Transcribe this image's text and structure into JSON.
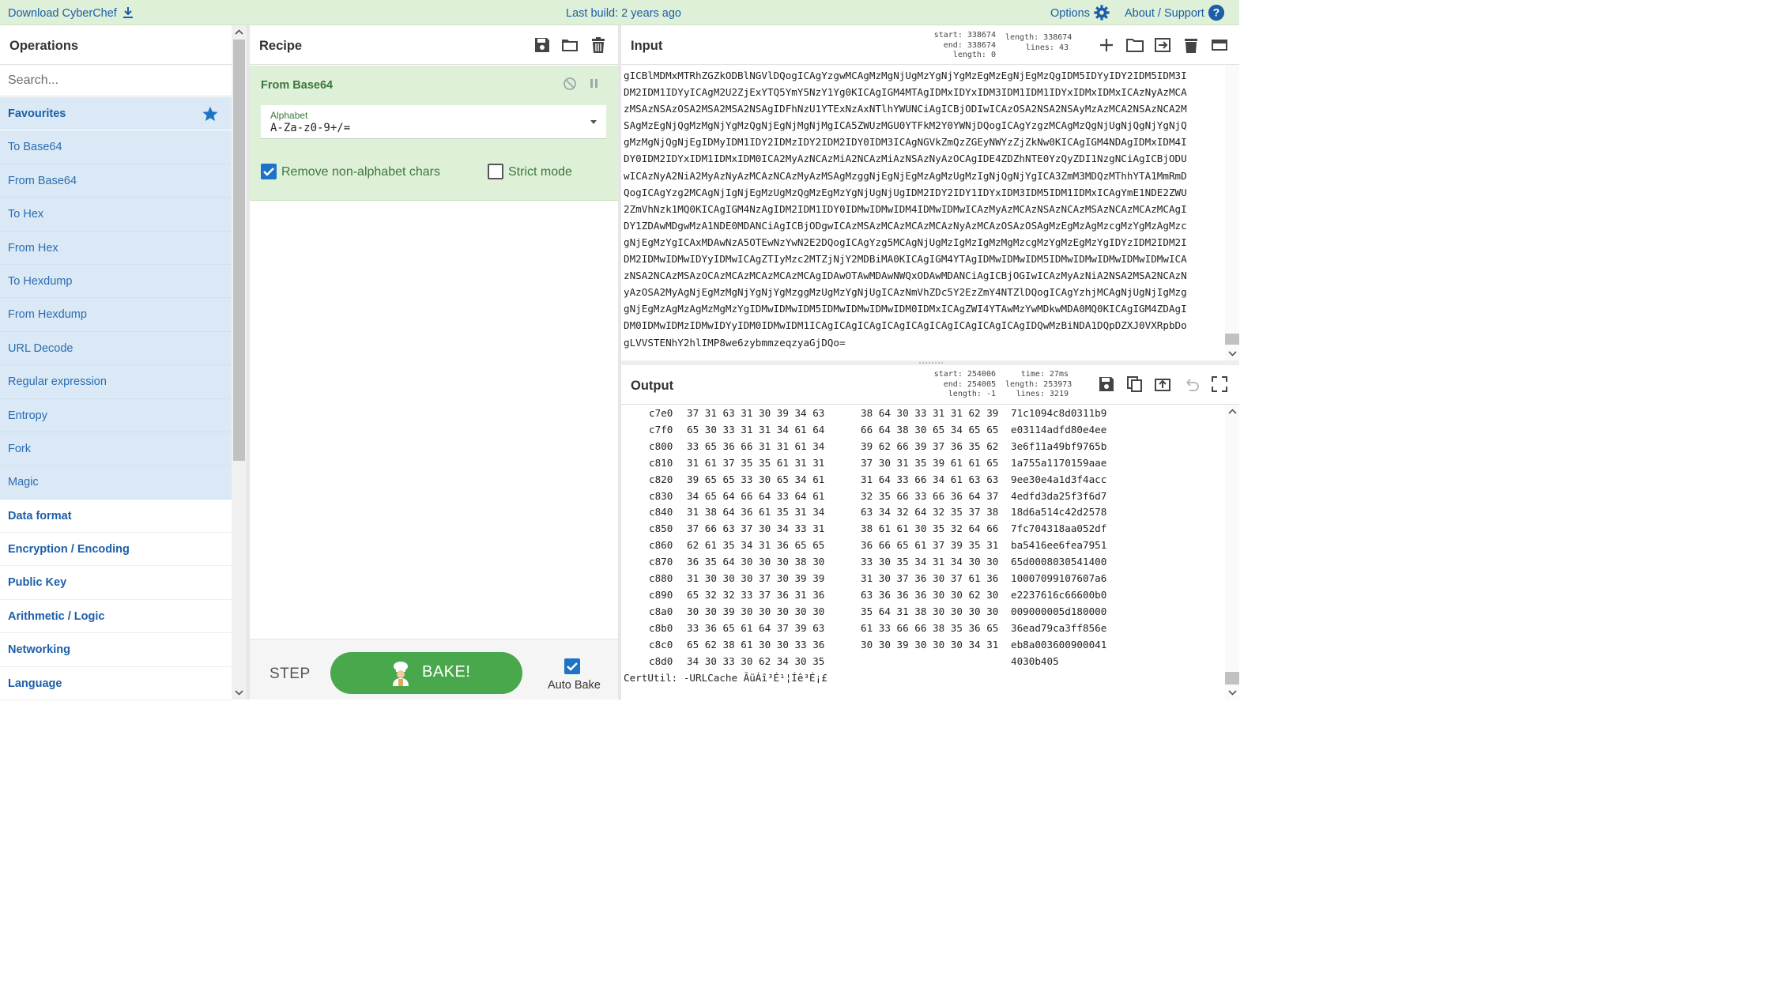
{
  "banner": {
    "download": "Download CyberChef",
    "build": "Last build: 2 years ago",
    "options": "Options",
    "about": "About / Support"
  },
  "operations": {
    "title": "Operations",
    "search_placeholder": "Search...",
    "items": [
      {
        "label": "Favourites",
        "kind": "favhead"
      },
      {
        "label": "To Base64",
        "kind": "fav"
      },
      {
        "label": "From Base64",
        "kind": "fav"
      },
      {
        "label": "To Hex",
        "kind": "fav"
      },
      {
        "label": "From Hex",
        "kind": "fav"
      },
      {
        "label": "To Hexdump",
        "kind": "fav"
      },
      {
        "label": "From Hexdump",
        "kind": "fav"
      },
      {
        "label": "URL Decode",
        "kind": "fav"
      },
      {
        "label": "Regular expression",
        "kind": "fav"
      },
      {
        "label": "Entropy",
        "kind": "fav"
      },
      {
        "label": "Fork",
        "kind": "fav"
      },
      {
        "label": "Magic",
        "kind": "fav"
      },
      {
        "label": "Data format",
        "kind": "cat"
      },
      {
        "label": "Encryption / Encoding",
        "kind": "cat"
      },
      {
        "label": "Public Key",
        "kind": "cat"
      },
      {
        "label": "Arithmetic / Logic",
        "kind": "cat"
      },
      {
        "label": "Networking",
        "kind": "cat"
      },
      {
        "label": "Language",
        "kind": "cat"
      }
    ]
  },
  "recipe": {
    "title": "Recipe",
    "operation": {
      "name": "From Base64",
      "alphabet_label": "Alphabet",
      "alphabet_value": "A-Za-z0-9+/=",
      "remove_non_alphabet_label": "Remove non-alphabet chars",
      "remove_non_alphabet_checked": true,
      "strict_mode_label": "Strict mode",
      "strict_mode_checked": false
    },
    "step_label": "STEP",
    "bake_label": "BAKE!",
    "auto_bake_label": "Auto Bake",
    "auto_bake_checked": true
  },
  "input": {
    "title": "Input",
    "stats": {
      "start": "338674",
      "end": "338674",
      "length_sel": "0",
      "length": "338674",
      "lines": "43"
    },
    "lines": [
      "gICBlMDMxMTRhZGZkODBlNGVlDQogICAgYzgwMCAgMzMgNjUgMzYgNjYgMzEgMzEgNjEgMzQgIDM5IDYyIDY2IDM5IDM3I",
      "DM2IDM1IDYyICAgM2U2ZjExYTQ5YmY5NzY1Yg0KICAgIGM4MTAgIDMxIDYxIDM3IDM1IDM1IDYxIDMxIDMxICAzNyAzMCA",
      "zMSAzNSAzOSA2MSA2MSA2NSAgIDFhNzU1YTExNzAxNTlhYWUNCiAgICBjODIwICAzOSA2NSA2NSAyMzAzMCA2NSAzNCA2M",
      "SAgMzEgNjQgMzMgNjYgMzQgNjEgNjMgNjMgICA5ZWUzMGU0YTFkM2Y0YWNjDQogICAgYzgzMCAgMzQgNjUgNjQgNjYgNjQ",
      "gMzMgNjQgNjEgIDMyIDM1IDY2IDMzIDY2IDM2IDY0IDM3ICAgNGVkZmQzZGEyNWYzZjZkNw0KICAgIGM4NDAgIDMxIDM4I",
      "DY0IDM2IDYxIDM1IDMxIDM0ICA2MyAzNCAzMiA2NCAzMiAzNSAzNyAzOCAgIDE4ZDZhNTE0YzQyZDI1NzgNCiAgICBjODU",
      "wICAzNyA2NiA2MyAzNyAzMCAzNCAzMyAzMSAgMzggNjEgNjEgMzAgMzUgMzIgNjQgNjYgICA3ZmM3MDQzMThhYTA1MmRmD",
      "QogICAgYzg2MCAgNjIgNjEgMzUgMzQgMzEgMzYgNjUgNjUgIDM2IDY2IDY1IDYxIDM3IDM5IDM1IDMxICAgYmE1NDE2ZWU",
      "2ZmVhNzk1MQ0KICAgIGM4NzAgIDM2IDM1IDY0IDMwIDMwIDM4IDMwIDMwICAzMyAzMCAzNSAzNCAzMSAzNCAzMCAzMCAgI",
      "DY1ZDAwMDgwMzA1NDE0MDANCiAgICBjODgwICAzMSAzMCAzMCAzMCAzNyAzMCAzOSAzOSAgMzEgMzAgMzcgMzYgMzAgMzc",
      "gNjEgMzYgICAxMDAwNzA5OTEwNzYwN2E2DQogICAgYzg5MCAgNjUgMzIgMzIgMzMgMzcgMzYgMzEgMzYgIDYzIDM2IDM2I",
      "DM2IDMwIDMwIDYyIDMwICAgZTIyMzc2MTZjNjY2MDBiMA0KICAgIGM4YTAgIDMwIDMwIDM5IDMwIDMwIDMwIDMwIDMwICA",
      "zNSA2NCAzMSAzOCAzMCAzMCAzMCAzMCAgIDAwOTAwMDAwNWQxODAwMDANCiAgICBjOGIwICAzMyAzNiA2NSA2MSA2NCAzN",
      "yAzOSA2MyAgNjEgMzMgNjYgNjYgMzggMzUgMzYgNjUgICAzNmVhZDc5Y2EzZmY4NTZlDQogICAgYzhjMCAgNjUgNjIgMzg",
      "gNjEgMzAgMzAgMzMgMzYgIDMwIDMwIDM5IDMwIDMwIDMwIDM0IDMxICAgZWI4YTAwMzYwMDkwMDA0MQ0KICAgIGM4ZDAgI",
      "DM0IDMwIDMzIDMwIDYyIDM0IDMwIDM1ICAgICAgICAgICAgICAgICAgICAgICAgICAgIDQwMzBiNDA1DQpDZXJ0VXRpbDo",
      "gLVVSTENhY2hlIMP8we6zybmmzeqzyaGjDQo="
    ]
  },
  "output": {
    "title": "Output",
    "stats": {
      "start": "254006",
      "end": "254005",
      "length_sel": "-1",
      "time": "27ms",
      "length": "253973",
      "lines": "3219"
    },
    "rows": [
      {
        "offset": "c7e0",
        "hex1": "37 31 63 31 30 39 34 63",
        "hex2": "38 64 30 33 31 31 62 39",
        "ascii": "71c1094c8d0311b9"
      },
      {
        "offset": "c7f0",
        "hex1": "65 30 33 31 31 34 61 64",
        "hex2": "66 64 38 30 65 34 65 65",
        "ascii": "e03114adfd80e4ee"
      },
      {
        "offset": "c800",
        "hex1": "33 65 36 66 31 31 61 34",
        "hex2": "39 62 66 39 37 36 35 62",
        "ascii": "3e6f11a49bf9765b"
      },
      {
        "offset": "c810",
        "hex1": "31 61 37 35 35 61 31 31",
        "hex2": "37 30 31 35 39 61 61 65",
        "ascii": "1a755a1170159aae"
      },
      {
        "offset": "c820",
        "hex1": "39 65 65 33 30 65 34 61",
        "hex2": "31 64 33 66 34 61 63 63",
        "ascii": "9ee30e4a1d3f4acc"
      },
      {
        "offset": "c830",
        "hex1": "34 65 64 66 64 33 64 61",
        "hex2": "32 35 66 33 66 36 64 37",
        "ascii": "4edfd3da25f3f6d7"
      },
      {
        "offset": "c840",
        "hex1": "31 38 64 36 61 35 31 34",
        "hex2": "63 34 32 64 32 35 37 38",
        "ascii": "18d6a514c42d2578"
      },
      {
        "offset": "c850",
        "hex1": "37 66 63 37 30 34 33 31",
        "hex2": "38 61 61 30 35 32 64 66",
        "ascii": "7fc704318aa052df"
      },
      {
        "offset": "c860",
        "hex1": "62 61 35 34 31 36 65 65",
        "hex2": "36 66 65 61 37 39 35 31",
        "ascii": "ba5416ee6fea7951"
      },
      {
        "offset": "c870",
        "hex1": "36 35 64 30 30 30 38 30",
        "hex2": "33 30 35 34 31 34 30 30",
        "ascii": "65d0008030541400"
      },
      {
        "offset": "c880",
        "hex1": "31 30 30 30 37 30 39 39",
        "hex2": "31 30 37 36 30 37 61 36",
        "ascii": "10007099107607a6"
      },
      {
        "offset": "c890",
        "hex1": "65 32 32 33 37 36 31 36",
        "hex2": "63 36 36 36 30 30 62 30",
        "ascii": "e2237616c66600b0"
      },
      {
        "offset": "c8a0",
        "hex1": "30 30 39 30 30 30 30 30",
        "hex2": "35 64 31 38 30 30 30 30",
        "ascii": "009000005d180000"
      },
      {
        "offset": "c8b0",
        "hex1": "33 36 65 61 64 37 39 63",
        "hex2": "61 33 66 66 38 35 36 65",
        "ascii": "36ead79ca3ff856e"
      },
      {
        "offset": "c8c0",
        "hex1": "65 62 38 61 30 30 33 36",
        "hex2": "30 30 39 30 30 30 34 31",
        "ascii": "eb8a003600900041"
      },
      {
        "offset": "c8d0",
        "hex1": "34 30 33 30 62 34 30 35",
        "hex2": "",
        "ascii": "4030b405"
      }
    ],
    "last_line": "CertUtil: -URLCache ÃüÁî³É¹¦Íê³É¡£"
  },
  "colors": {
    "banner_bg": "#dff0d8",
    "link": "#1c5ea9",
    "fav_bg": "#dae9f5",
    "recipe_op_bg": "#dff0d8",
    "bake_green": "#4aa84c",
    "checkbox_blue": "#1f73c7"
  }
}
